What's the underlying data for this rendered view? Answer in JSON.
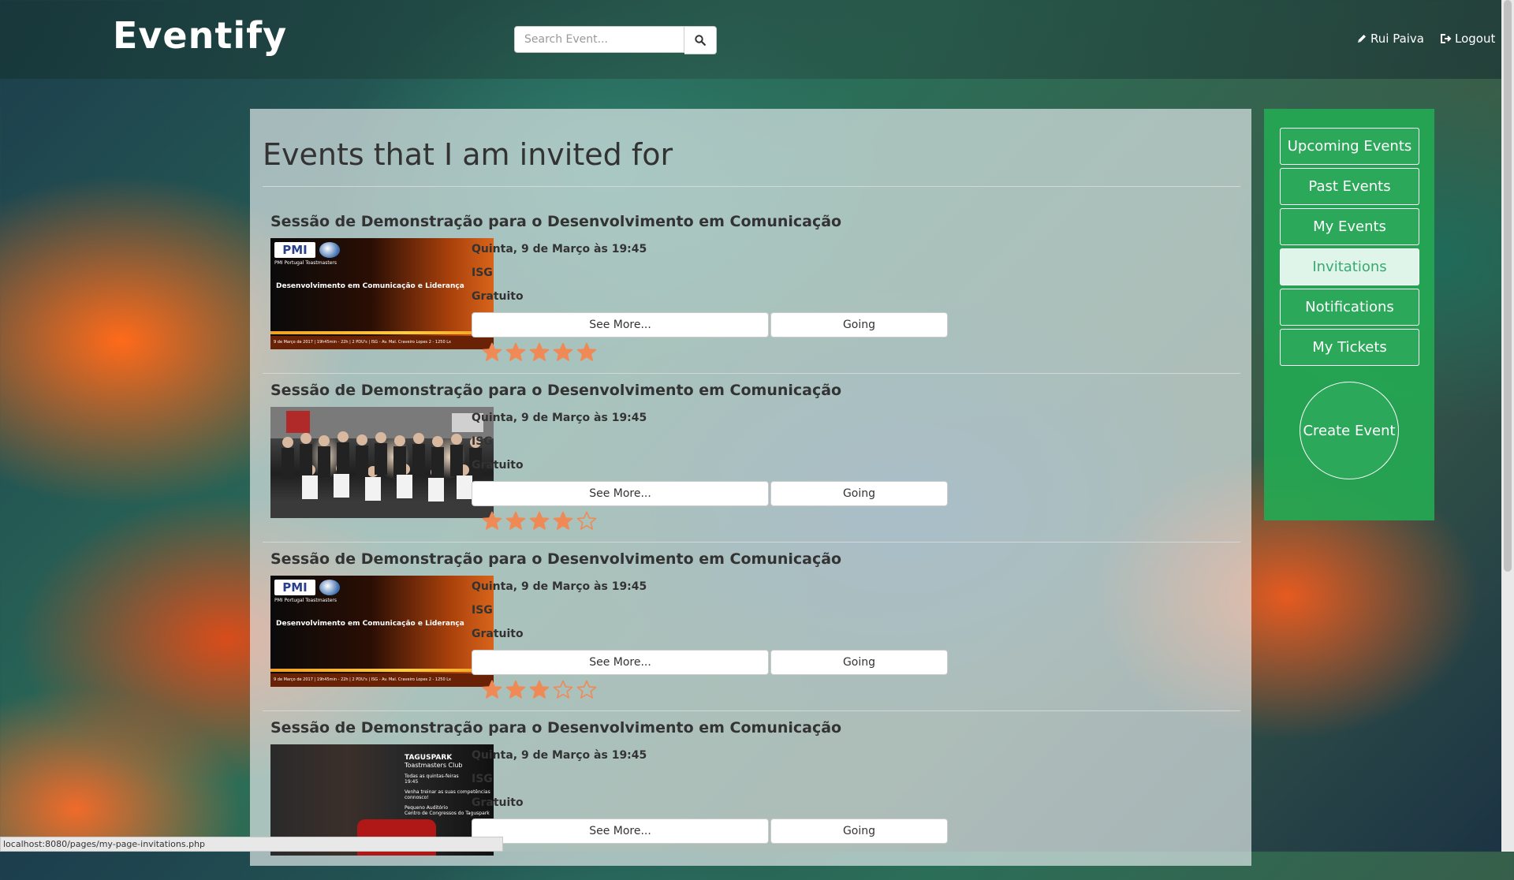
{
  "navbar": {
    "brand": "Eventify",
    "search_placeholder": "Search Event...",
    "user_name": "Rui Paiva",
    "logout_label": "Logout"
  },
  "page": {
    "title": "Events that I am invited for"
  },
  "events": [
    {
      "title": "Sessão de Demonstração para o Desenvolvimento em Comunicação",
      "date": "Quinta, 9 de Março às 19:45",
      "location": "ISG",
      "price": "Gratuito",
      "see_more": "See More...",
      "going": "Going",
      "rating": 5,
      "image": {
        "logo": "PMI",
        "sub": "PMI Portugal Toastmasters",
        "headline": "Desenvolvimento em Comunicação e Liderança",
        "footer": "9 de Março de 2017 | 19h45min - 22h | 2 PDU's | ISG - Av. Mal. Craveiro Lopes 2 - 1250 Lx"
      }
    },
    {
      "title": "Sessão de Demonstração para o Desenvolvimento em Comunicação",
      "date": "Quinta, 9 de Março às 19:45",
      "location": "ISG",
      "price": "Gratuito",
      "see_more": "See More...",
      "going": "Going",
      "rating": 4
    },
    {
      "title": "Sessão de Demonstração para o Desenvolvimento em Comunicação",
      "date": "Quinta, 9 de Março às 19:45",
      "location": "ISG",
      "price": "Gratuito",
      "see_more": "See More...",
      "going": "Going",
      "rating": 3,
      "image": {
        "logo": "PMI",
        "sub": "PMI Portugal Toastmasters",
        "headline": "Desenvolvimento em Comunicação e Liderança",
        "footer": "9 de Março de 2017 | 19h45min - 22h | 2 PDU's | ISG - Av. Mal. Craveiro Lopes 2 - 1250 Lx"
      }
    },
    {
      "title": "Sessão de Demonstração para o Desenvolvimento em Comunicação",
      "date": "Quinta, 9 de Março às 19:45",
      "location": "ISG",
      "price": "Gratuito",
      "see_more": "See More...",
      "going": "Going",
      "image": {
        "title": "TAGUSPARK",
        "club": "Toastmasters Club",
        "line1": "Todas as quintas-feiras",
        "line2": "19:45",
        "line3": "Venha treinar as suas competências connosco!",
        "line4": "Pequeno Auditório",
        "line5": "Centro de Congressos do Taguspark"
      }
    }
  ],
  "sidebar": {
    "items": [
      {
        "label": "Upcoming Events",
        "active": false
      },
      {
        "label": "Past Events",
        "active": false
      },
      {
        "label": "My Events",
        "active": false
      },
      {
        "label": "Invitations",
        "active": true
      },
      {
        "label": "Notifications",
        "active": false
      },
      {
        "label": "My Tickets",
        "active": false
      }
    ],
    "create_label": "Create Event"
  },
  "status_url": "localhost:8080/pages/my-page-invitations.php",
  "colors": {
    "sidebar_green": "#2ca85a",
    "active_bg": "#dff5ea",
    "star_orange": "#ef8a57"
  }
}
